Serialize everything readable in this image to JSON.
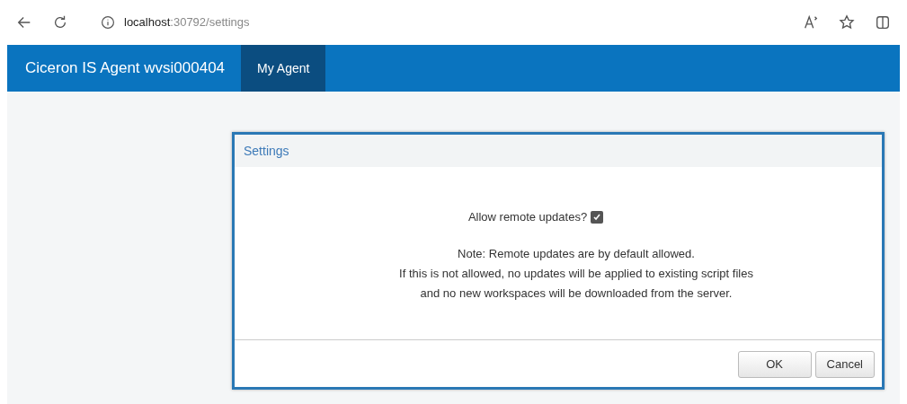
{
  "browser": {
    "url_host": "localhost",
    "url_path": ":30792/settings"
  },
  "navbar": {
    "brand": "Ciceron IS Agent wvsi000404",
    "links": [
      {
        "label": "My Agent",
        "selected": true
      }
    ]
  },
  "dialog": {
    "title": "Settings",
    "option": {
      "label": "Allow remote updates?",
      "checked": true
    },
    "note_lines": [
      "Note: Remote updates are by default allowed.",
      "If this is not allowed, no updates will be applied to existing script files",
      "and no new workspaces will be downloaded from the server."
    ],
    "buttons": [
      "OK",
      "Cancel"
    ]
  }
}
